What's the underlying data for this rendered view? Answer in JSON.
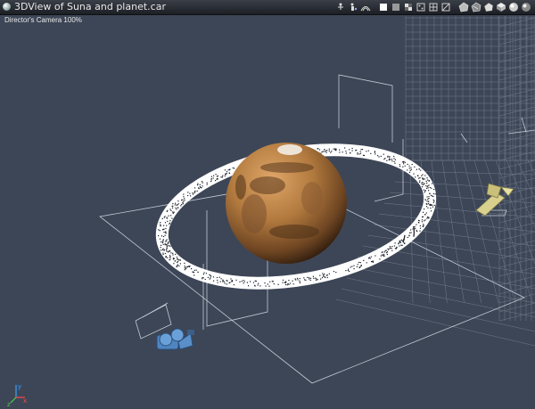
{
  "window": {
    "title": "3DView of Suna and planet.car"
  },
  "viewport": {
    "camera_label": "Director's Camera 100%"
  },
  "toolbar": {
    "icons": [
      "skeleton-icon",
      "figure-icon",
      "hair-icon",
      "render-style-white-icon",
      "render-style-gray-icon",
      "render-style-checker-icon",
      "render-style-dots-icon",
      "render-style-grid-icon",
      "render-style-lines-icon",
      "render-style-flat-icon",
      "render-style-smooth-icon",
      "render-style-shaded-icon",
      "render-style-texture-icon",
      "render-style-sphere-icon",
      "render-style-full-icon"
    ]
  },
  "axes": {
    "x": "x",
    "y": "y",
    "z": "z"
  },
  "colors": {
    "background": "#3d4656",
    "grid": "#a9b3c2",
    "ring": "#ffffff",
    "planet": "#b27a3e",
    "camera": "#6aa0d8",
    "light": "#d8d08c"
  }
}
